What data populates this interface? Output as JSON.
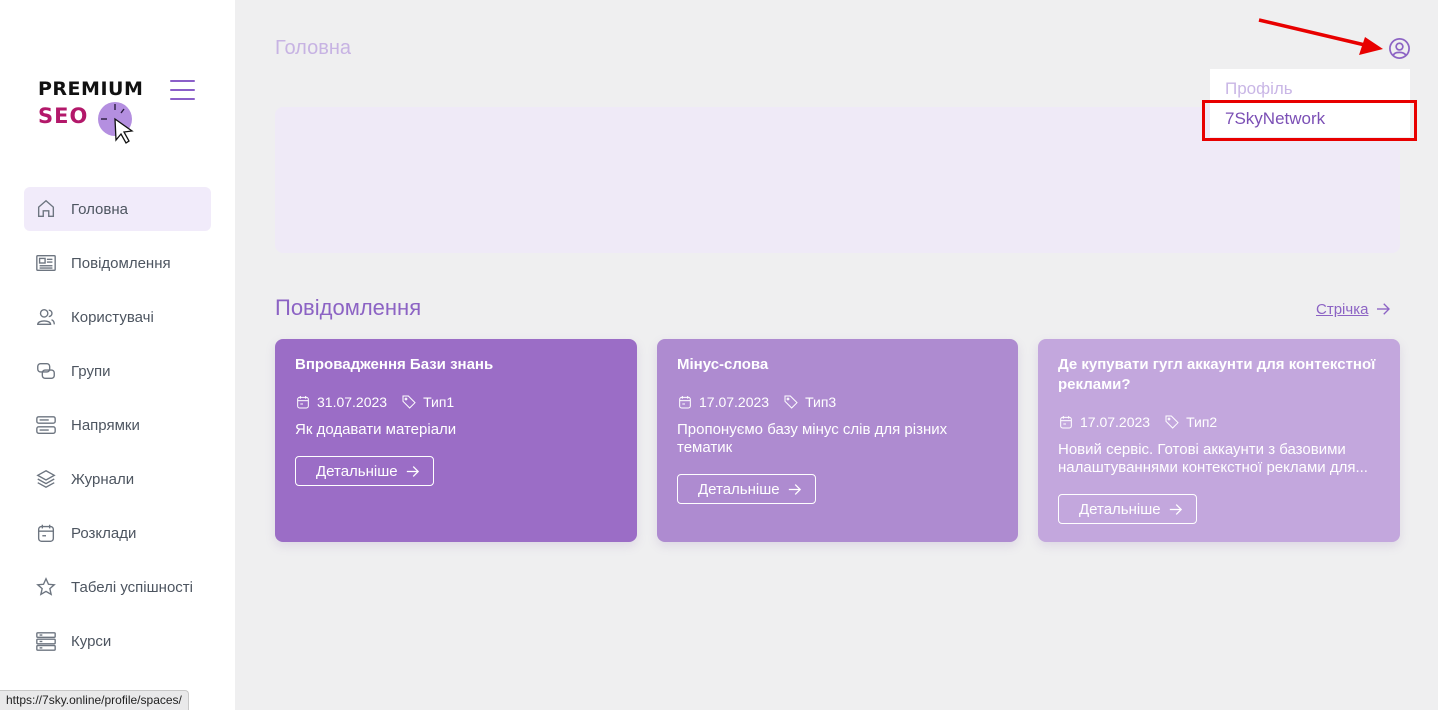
{
  "logo": {
    "premium": "PREMIUM",
    "seo": "SEO"
  },
  "sidebar": {
    "items": [
      {
        "label": "Головна",
        "icon": "home-icon",
        "active": true
      },
      {
        "label": "Повідомлення",
        "icon": "newspaper-icon"
      },
      {
        "label": "Користувачі",
        "icon": "users-icon"
      },
      {
        "label": "Групи",
        "icon": "groups-icon"
      },
      {
        "label": "Напрямки",
        "icon": "directions-icon"
      },
      {
        "label": "Журнали",
        "icon": "layers-icon"
      },
      {
        "label": "Розклади",
        "icon": "calendar-icon"
      },
      {
        "label": "Табелі успішності",
        "icon": "star-icon"
      },
      {
        "label": "Курси",
        "icon": "server-icon"
      }
    ]
  },
  "status_url": "https://7sky.online/profile/spaces/",
  "header": {
    "title": "Головна"
  },
  "user_menu": {
    "profile": "Профіль",
    "network": "7SkyNetwork"
  },
  "messages": {
    "title": "Повідомлення",
    "feed_link": "Стрічка",
    "cards": [
      {
        "title": "Впровадження Бази знань",
        "date": "31.07.2023",
        "type": "Тип1",
        "desc": "Як додавати матеріали",
        "button": "Детальніше"
      },
      {
        "title": "Мінус-слова",
        "date": "17.07.2023",
        "type": "Тип3",
        "desc": "Пропонуємо базу мінус слів для різних тематик",
        "button": "Детальніше"
      },
      {
        "title": "Де купувати гугл аккаунти для контекстної реклами?",
        "date": "17.07.2023",
        "type": "Тип2",
        "desc": "Новий сервіс. Готові аккаунти з базовими налаштуваннями контекстної реклами для...",
        "button": "Детальніше"
      }
    ]
  },
  "colors": {
    "accent": "#8c63c4",
    "annotation": "#e80000"
  }
}
